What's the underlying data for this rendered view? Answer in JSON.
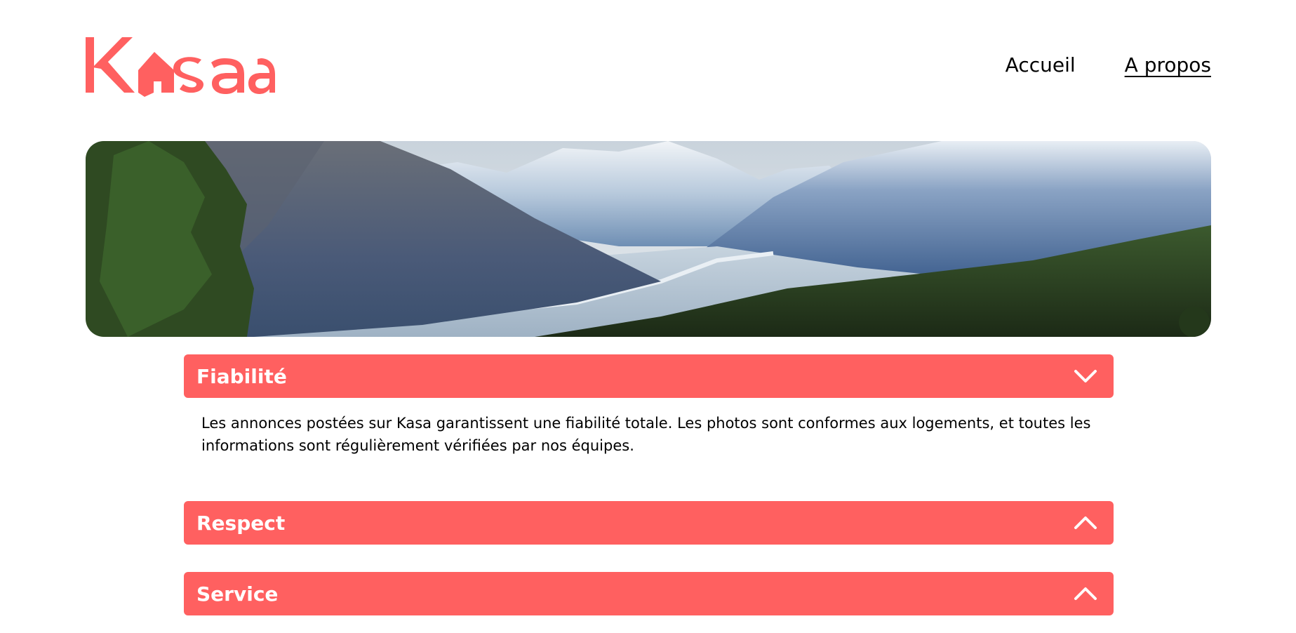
{
  "header": {
    "logo_text": "Kasa",
    "nav": [
      {
        "label": "Accueil",
        "active": false
      },
      {
        "label": "A propos",
        "active": true
      }
    ]
  },
  "banner": {
    "alt": "Paysage de montagnes"
  },
  "collapses": [
    {
      "title": "Fiabilité",
      "open": true,
      "chevron": "chevron-down-icon",
      "content": "Les annonces postées sur Kasa garantissent une fiabilité totale. Les photos sont conformes aux logements, et toutes les informations sont régulièrement vérifiées par nos équipes."
    },
    {
      "title": "Respect",
      "open": false,
      "chevron": "chevron-up-icon"
    },
    {
      "title": "Service",
      "open": false,
      "chevron": "chevron-up-icon"
    }
  ],
  "colors": {
    "brand": "#ff6060",
    "text": "#000000",
    "background": "#ffffff"
  }
}
